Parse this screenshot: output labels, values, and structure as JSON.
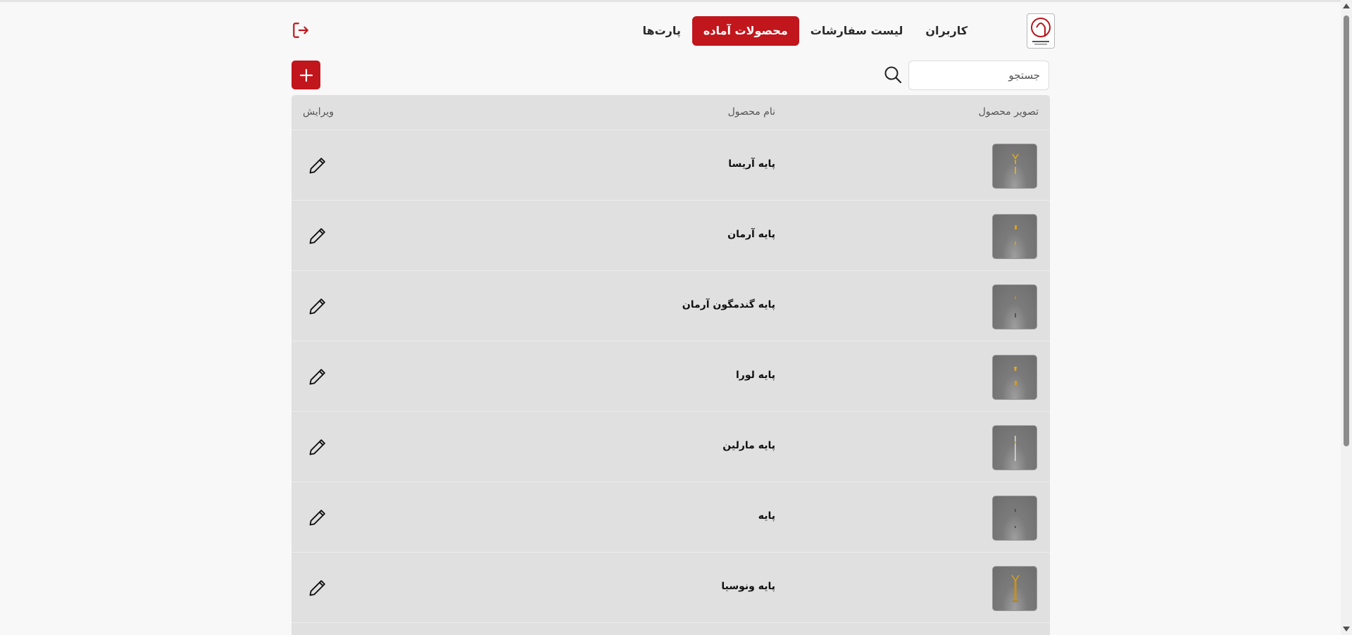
{
  "header": {
    "logo_icon": "company-seal-logo",
    "nav": [
      {
        "label": "کاربران",
        "active": false
      },
      {
        "label": "لیست سفارشات",
        "active": false
      },
      {
        "label": "محصولات آماده",
        "active": true
      },
      {
        "label": "پارت‌ها",
        "active": false
      }
    ],
    "logout_icon": "logout-icon"
  },
  "toolbar": {
    "search_placeholder": "جستجو",
    "search_icon": "search-icon",
    "add_icon": "plus-icon"
  },
  "table": {
    "headers": {
      "image": "تصویر محصول",
      "name": "نام محصول",
      "edit": "ویرایش"
    },
    "rows": [
      {
        "name": "پایه آریسا"
      },
      {
        "name": "پایه آرمان"
      },
      {
        "name": "پایه گندمگون آرمان"
      },
      {
        "name": "پایه لورا"
      },
      {
        "name": "پایه مارلین"
      },
      {
        "name": "پایه"
      },
      {
        "name": "پایه ونوسیا"
      }
    ]
  },
  "colors": {
    "accent": "#c0161c",
    "page_background": "#f8f8f8",
    "table_background": "#e1e0e0"
  }
}
